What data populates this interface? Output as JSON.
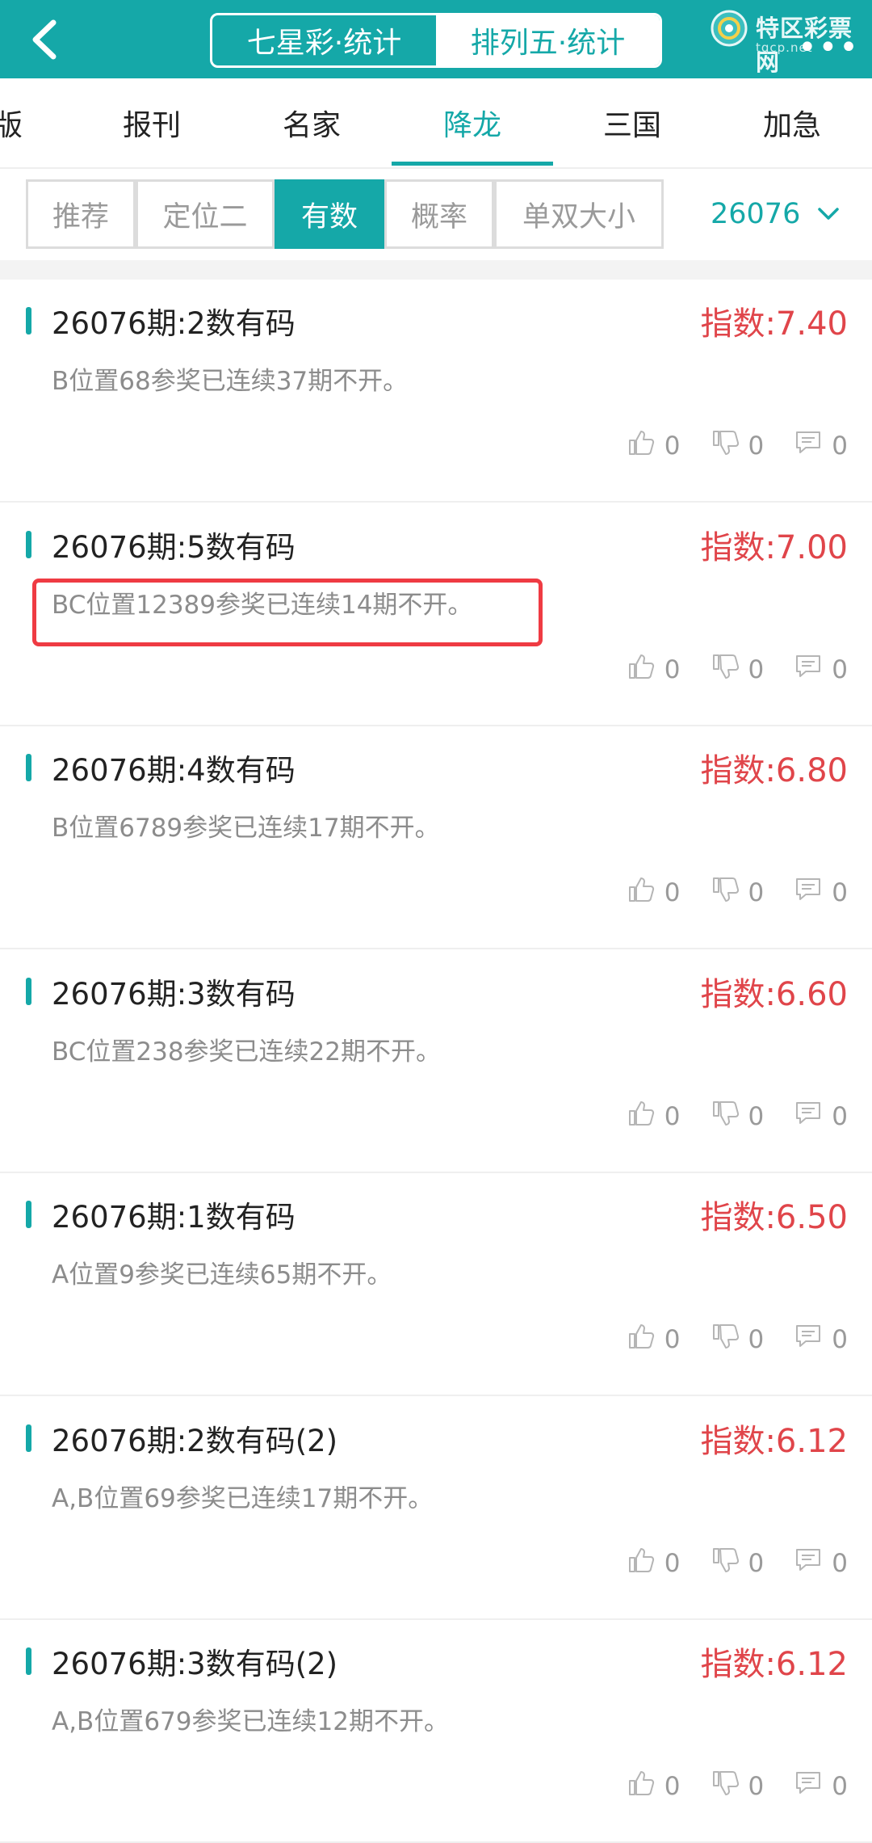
{
  "header": {
    "tabs": [
      {
        "label": "七星彩·统计",
        "active": false
      },
      {
        "label": "排列五·统计",
        "active": true
      }
    ],
    "brand": {
      "name": "特区彩票网",
      "url": "tqcp.net"
    },
    "more_label": "•••"
  },
  "category_tabs": [
    {
      "label": "版",
      "active": false
    },
    {
      "label": "报刊",
      "active": false
    },
    {
      "label": "名家",
      "active": false
    },
    {
      "label": "降龙",
      "active": true
    },
    {
      "label": "三国",
      "active": false
    },
    {
      "label": "加急",
      "active": false
    }
  ],
  "filters": [
    {
      "label": "推荐",
      "active": false
    },
    {
      "label": "定位二",
      "active": false
    },
    {
      "label": "有数",
      "active": true
    },
    {
      "label": "概率",
      "active": false
    },
    {
      "label": "单双大小",
      "active": false
    }
  ],
  "issue_select": {
    "value": "26076"
  },
  "cards": [
    {
      "title": "26076期:2数有码",
      "index": "指数:7.40",
      "desc": "B位置68参奖已连续37期不开。",
      "likes": "0",
      "dislikes": "0",
      "comments": "0"
    },
    {
      "title": "26076期:5数有码",
      "index": "指数:7.00",
      "desc": "BC位置12389参奖已连续14期不开。",
      "likes": "0",
      "dislikes": "0",
      "comments": "0",
      "highlighted": true
    },
    {
      "title": "26076期:4数有码",
      "index": "指数:6.80",
      "desc": "B位置6789参奖已连续17期不开。",
      "likes": "0",
      "dislikes": "0",
      "comments": "0"
    },
    {
      "title": "26076期:3数有码",
      "index": "指数:6.60",
      "desc": "BC位置238参奖已连续22期不开。",
      "likes": "0",
      "dislikes": "0",
      "comments": "0"
    },
    {
      "title": "26076期:1数有码",
      "index": "指数:6.50",
      "desc": "A位置9参奖已连续65期不开。",
      "likes": "0",
      "dislikes": "0",
      "comments": "0"
    },
    {
      "title": "26076期:2数有码(2)",
      "index": "指数:6.12",
      "desc": "A,B位置69参奖已连续17期不开。",
      "likes": "0",
      "dislikes": "0",
      "comments": "0"
    },
    {
      "title": "26076期:3数有码(2)",
      "index": "指数:6.12",
      "desc": "A,B位置679参奖已连续12期不开。",
      "likes": "0",
      "dislikes": "0",
      "comments": "0"
    }
  ],
  "colors": {
    "accent": "#15a8a8",
    "index_red": "#e0454a",
    "highlight": "#ef3b43"
  }
}
